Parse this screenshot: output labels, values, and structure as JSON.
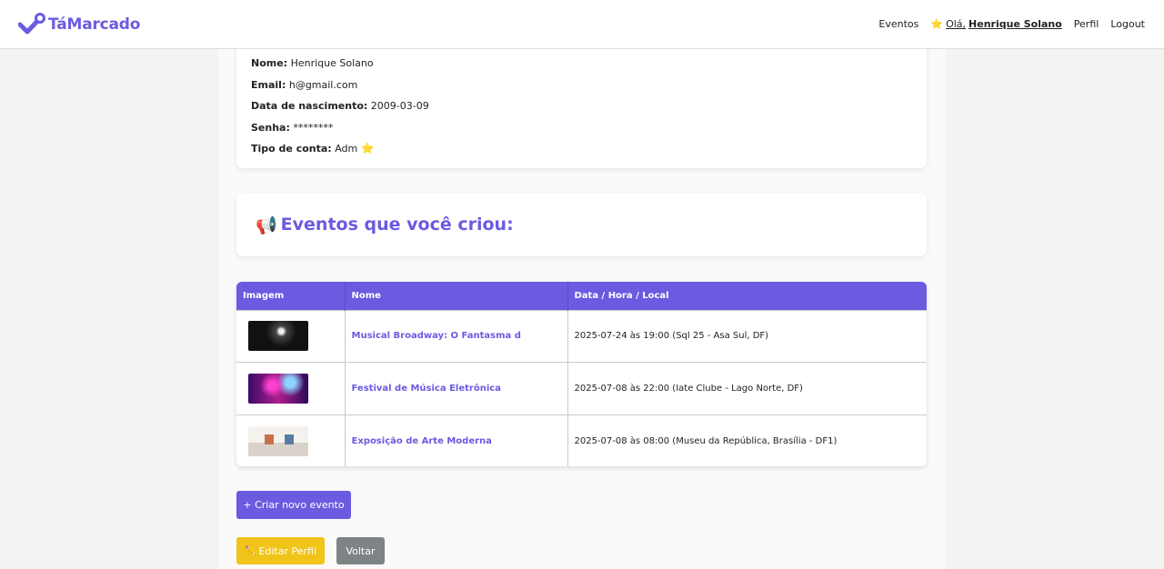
{
  "nav": {
    "brand": "TáMarcado",
    "links": {
      "events": "Eventos",
      "profile": "Perfil",
      "logout": "Logout"
    },
    "greeting_prefix": "Olá,",
    "greeting_name": "Henrique Solano",
    "greeting_icon": "⭐"
  },
  "profile": {
    "fields": [
      {
        "label": "Nome:",
        "value": "Henrique Solano"
      },
      {
        "label": "Email:",
        "value": "h@gmail.com"
      },
      {
        "label": "Data de nascimento:",
        "value": "2009-03-09"
      },
      {
        "label": "Senha:",
        "value": "********"
      },
      {
        "label": "Tipo de conta:",
        "value": "Adm"
      }
    ],
    "account_type_icon": "⭐"
  },
  "events_section": {
    "icon": "📢",
    "title": "Eventos que você criou:"
  },
  "events_table": {
    "columns": [
      "Imagem",
      "Nome",
      "Data / Hora / Local"
    ],
    "rows": [
      {
        "name": "Musical Broadway: O Fantasma d",
        "when": "2025-07-24 às 19:00 (Sql 25 - Asa Sul, DF)"
      },
      {
        "name": "Festival de Música Eletrônica",
        "when": "2025-07-08 às 22:00 (Iate Clube - Lago Norte, DF)"
      },
      {
        "name": "Exposição de Arte Moderna",
        "when": "2025-07-08 às 08:00 (Museu da República, Brasília - DF1)"
      }
    ]
  },
  "actions": {
    "create_event": "+ Criar novo evento",
    "edit_profile_icon": "✏️",
    "edit_profile": "Editar Perfil",
    "back": "Voltar"
  },
  "colors": {
    "accent": "#6b5be0",
    "edit_button": "#f0c419",
    "back_button": "#7e8386"
  }
}
